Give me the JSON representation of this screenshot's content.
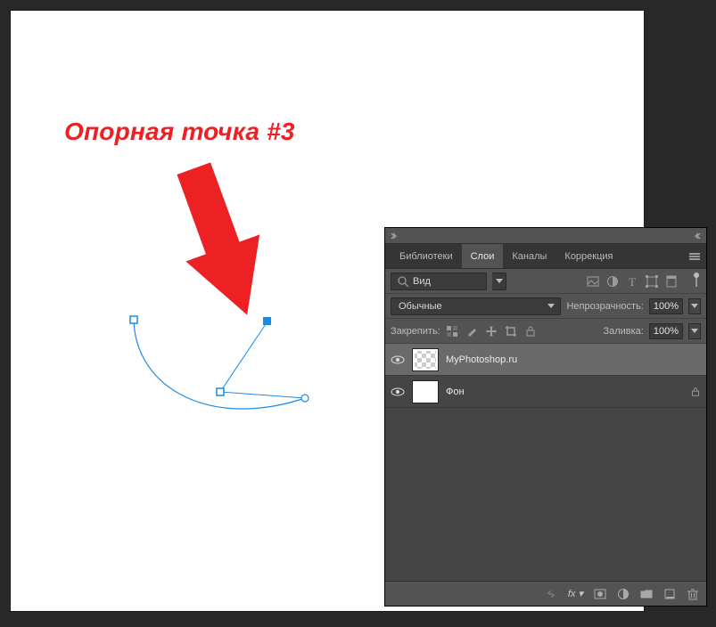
{
  "annotation": {
    "label": "Опорная точка #3"
  },
  "panel": {
    "tabs": [
      "Библиотеки",
      "Слои",
      "Каналы",
      "Коррекция"
    ],
    "active_tab": 1,
    "search": {
      "label": "Вид"
    },
    "filter_icons": [
      "image-icon",
      "adjust-icon",
      "text-icon",
      "shape-icon",
      "smart-icon"
    ],
    "blend": {
      "value": "Обычные",
      "opacity_label": "Непрозрачность:",
      "opacity_value": "100%"
    },
    "lockrow": {
      "label": "Закрепить:",
      "fill_label": "Заливка:",
      "fill_value": "100%"
    },
    "lock_icons": [
      "lock-pixels-icon",
      "lock-brush-icon",
      "lock-move-icon",
      "lock-crop-icon",
      "lock-all-icon"
    ],
    "layers": [
      {
        "name": "MyPhotoshop.ru",
        "selected": true,
        "checker": true,
        "locked": false
      },
      {
        "name": "Фон",
        "selected": false,
        "checker": false,
        "locked": true
      }
    ],
    "footer_icons": [
      "link-icon",
      "fx-icon",
      "mask-icon",
      "adjustment-icon",
      "folder-icon",
      "new-icon",
      "trash-icon"
    ]
  }
}
